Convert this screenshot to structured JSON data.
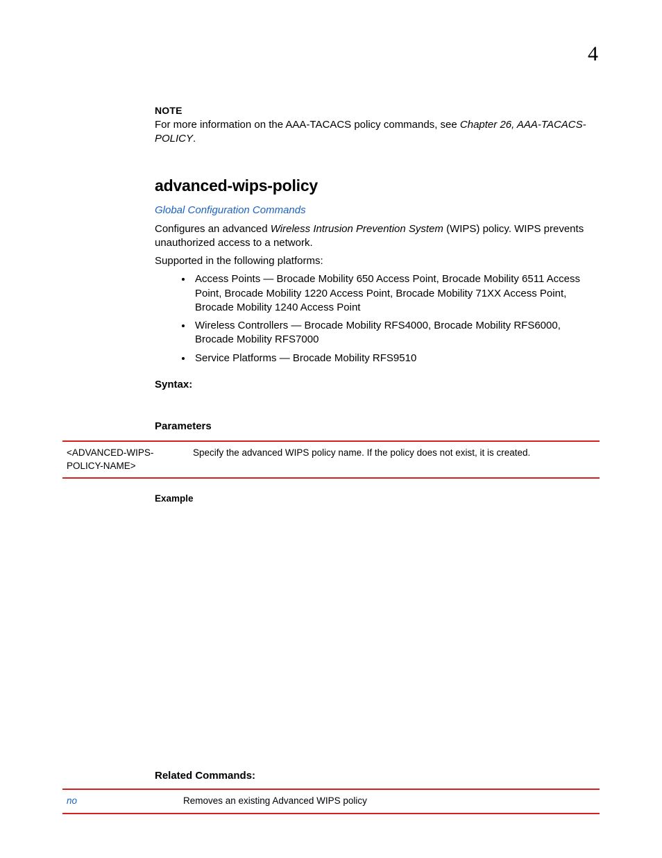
{
  "chapter_number": "4",
  "note": {
    "label": "NOTE",
    "prefix": "For more information on the AAA-TACACS policy commands, see ",
    "italic": "Chapter 26, AAA-TACACS-POLICY",
    "suffix": "."
  },
  "section_title": "advanced-wips-policy",
  "crossref": "Global Configuration Commands",
  "desc": {
    "pre": "Configures an advanced ",
    "italic": "Wireless Intrusion Prevention System",
    "post": " (WIPS) policy. WIPS prevents unauthorized access to a network."
  },
  "supported_heading": "Supported in the following platforms:",
  "bullets": [
    "Access Points — Brocade Mobility 650 Access Point, Brocade Mobility 6511 Access Point, Brocade Mobility 1220 Access Point, Brocade Mobility 71XX Access Point, Brocade Mobility 1240 Access Point",
    "Wireless Controllers — Brocade Mobility RFS4000, Brocade Mobility RFS6000, Brocade Mobility RFS7000",
    "Service Platforms — Brocade Mobility RFS9510"
  ],
  "syntax_label": "Syntax:",
  "parameters_label": "Parameters",
  "params": {
    "name": "<ADVANCED-WIPS-POLICY-NAME>",
    "desc": "Specify the advanced WIPS policy name. If the policy does not exist, it is created."
  },
  "example_label": "Example",
  "related_label": "Related Commands:",
  "related": {
    "cmd": "no",
    "desc": "Removes an existing Advanced WIPS policy"
  }
}
